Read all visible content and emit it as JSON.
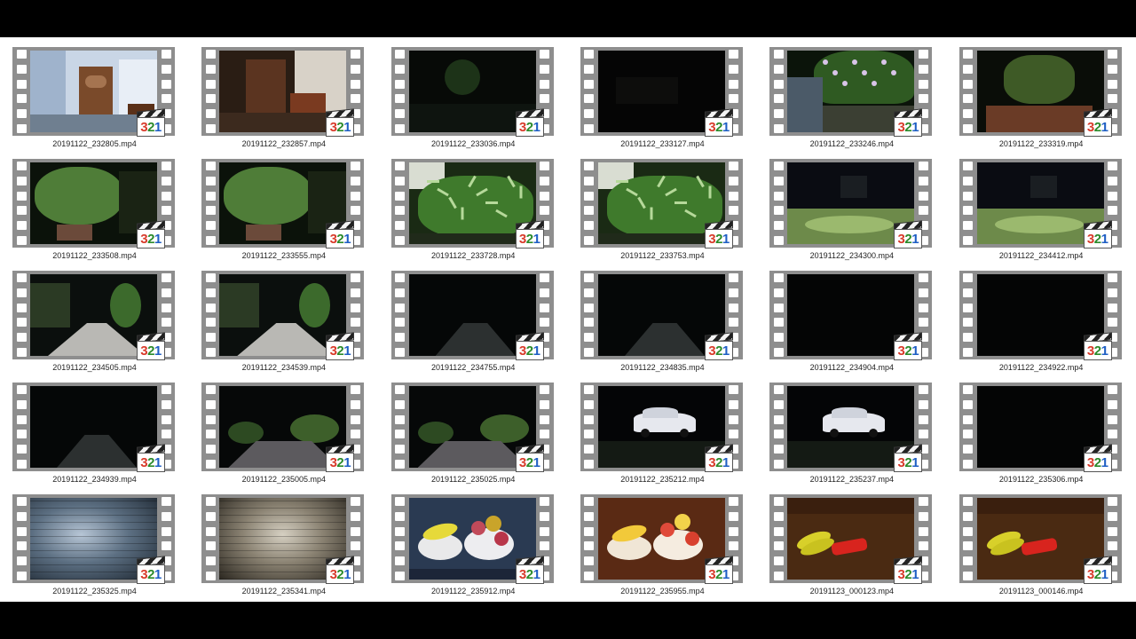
{
  "explorer": {
    "view": "large-icons",
    "files": [
      {
        "name": "20191122_232805.mp4",
        "scene": "room-door"
      },
      {
        "name": "20191122_232857.mp4",
        "scene": "room-dim"
      },
      {
        "name": "20191122_233036.mp4",
        "scene": "dark-yard"
      },
      {
        "name": "20191122_233127.mp4",
        "scene": "very-dark"
      },
      {
        "name": "20191122_233246.mp4",
        "scene": "flowers"
      },
      {
        "name": "20191122_233319.mp4",
        "scene": "plants-wall"
      },
      {
        "name": "20191122_233508.mp4",
        "scene": "potted-plant"
      },
      {
        "name": "20191122_233555.mp4",
        "scene": "potted-plant"
      },
      {
        "name": "20191122_233728.mp4",
        "scene": "bright-plants"
      },
      {
        "name": "20191122_233753.mp4",
        "scene": "bright-plants"
      },
      {
        "name": "20191122_234300.mp4",
        "scene": "night-lawn"
      },
      {
        "name": "20191122_234412.mp4",
        "scene": "night-lawn"
      },
      {
        "name": "20191122_234505.mp4",
        "scene": "lit-road"
      },
      {
        "name": "20191122_234539.mp4",
        "scene": "lit-road"
      },
      {
        "name": "20191122_234755.mp4",
        "scene": "dark-road"
      },
      {
        "name": "20191122_234835.mp4",
        "scene": "dark-road"
      },
      {
        "name": "20191122_234904.mp4",
        "scene": "black"
      },
      {
        "name": "20191122_234922.mp4",
        "scene": "black"
      },
      {
        "name": "20191122_234939.mp4",
        "scene": "dark-road"
      },
      {
        "name": "20191122_235005.mp4",
        "scene": "shrubs-road"
      },
      {
        "name": "20191122_235025.mp4",
        "scene": "shrubs-road"
      },
      {
        "name": "20191122_235212.mp4",
        "scene": "white-car"
      },
      {
        "name": "20191122_235237.mp4",
        "scene": "white-car"
      },
      {
        "name": "20191122_235306.mp4",
        "scene": "black"
      },
      {
        "name": "20191122_235325.mp4",
        "scene": "brick-cool"
      },
      {
        "name": "20191122_235341.mp4",
        "scene": "brick-warm"
      },
      {
        "name": "20191122_235912.mp4",
        "scene": "fruit-cool"
      },
      {
        "name": "20191122_235955.mp4",
        "scene": "fruit-warm"
      },
      {
        "name": "20191123_000123.mp4",
        "scene": "bananas-can"
      },
      {
        "name": "20191123_000146.mp4",
        "scene": "bananas-can"
      }
    ],
    "badge": {
      "digits": [
        "3",
        "2",
        "1"
      ]
    }
  },
  "colors": {
    "film_strip": "#8e8e8e",
    "background": "#ffffff",
    "letterbox": "#000000"
  }
}
